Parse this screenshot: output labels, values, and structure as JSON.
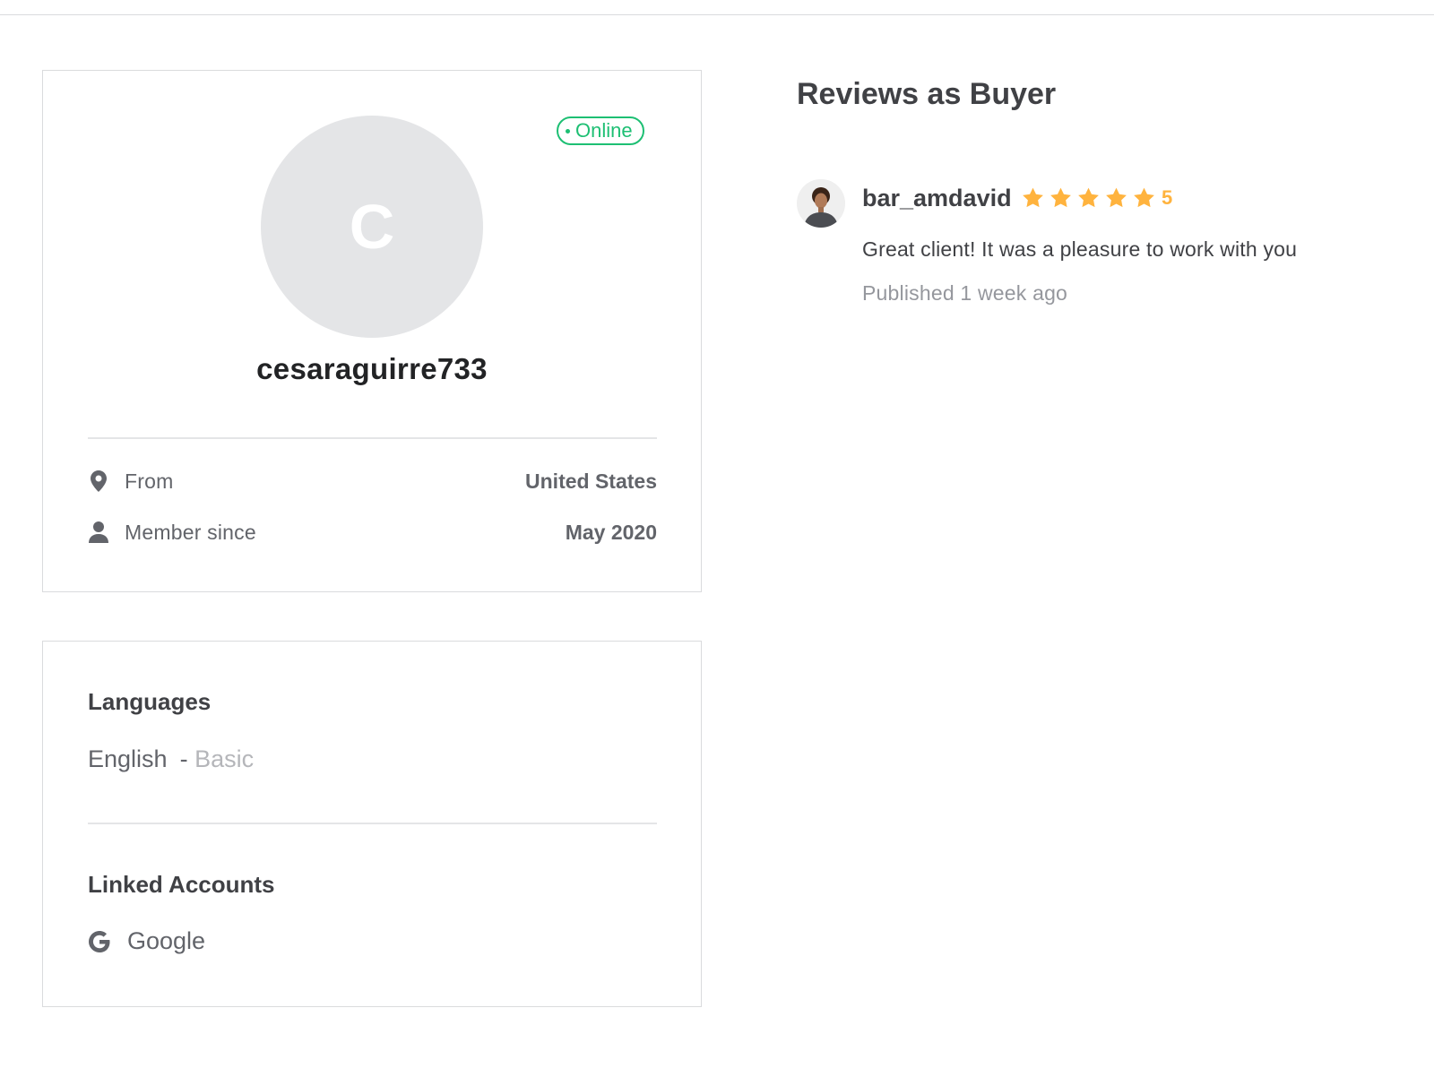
{
  "profile": {
    "status": "Online",
    "avatar_initial": "C",
    "username": "cesaraguirre733",
    "from_label": "From",
    "from_value": "United States",
    "member_label": "Member since",
    "member_value": "May 2020",
    "icons": {
      "location": "location-pin-icon",
      "member": "user-icon"
    },
    "colors": {
      "online": "#1dbf73",
      "avatar_bg": "#e4e5e7"
    }
  },
  "info": {
    "languages_title": "Languages",
    "language": "English",
    "language_separator": "-",
    "language_level": "Basic",
    "linked_title": "Linked Accounts",
    "linked_account": "Google",
    "linked_icon": "google-icon"
  },
  "reviews": {
    "title": "Reviews as Buyer",
    "items": [
      {
        "reviewer": "bar_amdavid",
        "rating": 5,
        "rating_label": "5",
        "text": "Great client! It was a pleasure to work with you",
        "published": "Published 1 week ago"
      }
    ],
    "star_color": "#ffb33e"
  }
}
